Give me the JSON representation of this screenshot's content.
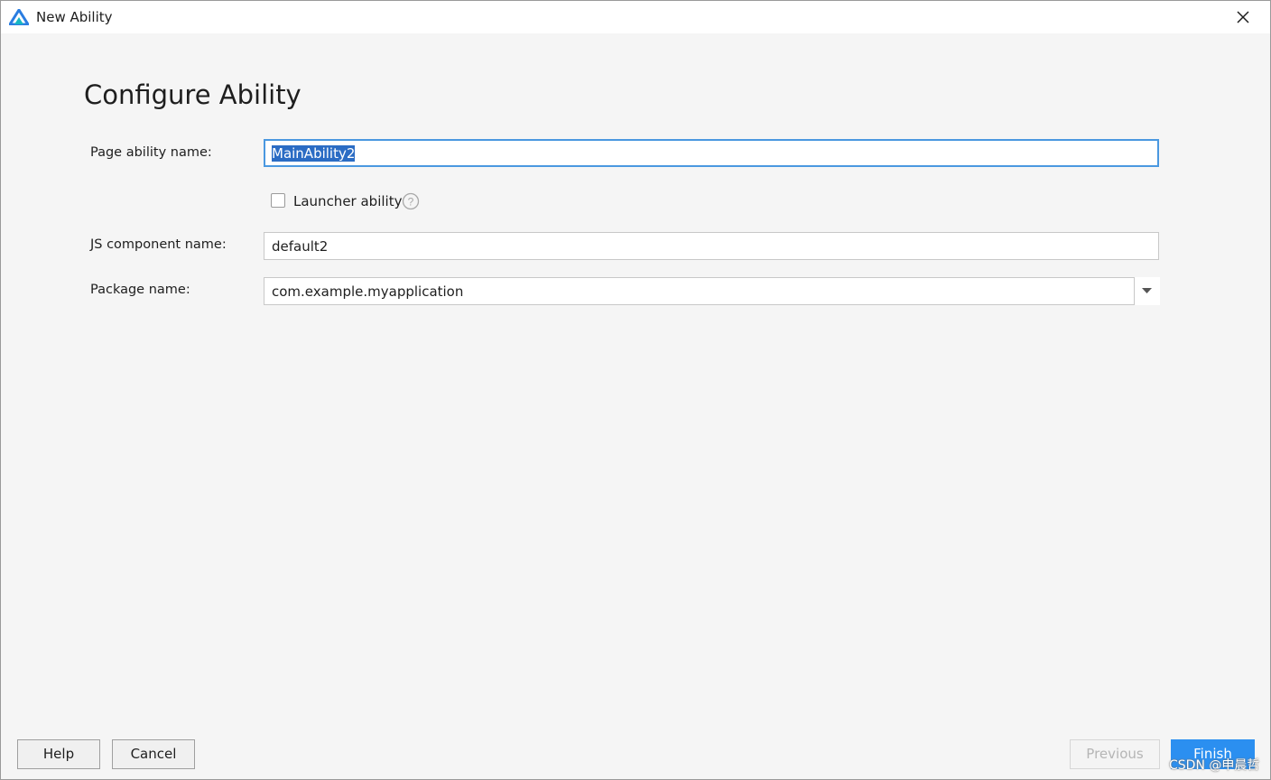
{
  "window": {
    "title": "New Ability",
    "icon": "harmonyos-logo-icon",
    "close_icon": "close-icon"
  },
  "heading": "Configure Ability",
  "form": {
    "page_ability_name": {
      "label": "Page ability name:",
      "value": "MainAbility2",
      "selected": true
    },
    "launcher_ability": {
      "label": "Launcher ability",
      "checked": false,
      "help_icon": "question-mark-icon"
    },
    "js_component_name": {
      "label": "JS component name:",
      "value": "default2"
    },
    "package_name": {
      "label": "Package name:",
      "value": "com.example.myapplication",
      "dropdown_icon": "chevron-down-icon"
    }
  },
  "footer": {
    "help": "Help",
    "cancel": "Cancel",
    "previous": "Previous",
    "finish": "Finish"
  },
  "watermark": "CSDN @申晨哲",
  "colors": {
    "accent": "#2b8ff0",
    "selection": "#2b6cc4",
    "focus_border": "#4a98e0",
    "background": "#f5f5f5"
  }
}
